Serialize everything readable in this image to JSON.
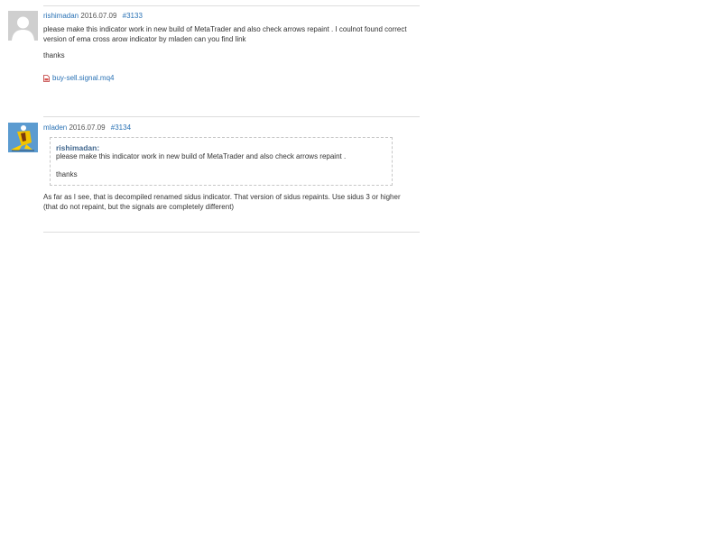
{
  "posts": [
    {
      "author": "rishimadan",
      "date": "2016.07.09",
      "number": "#3133",
      "avatar_icon": "default-user-avatar-icon",
      "paragraphs": [
        "please make this indicator work in new build of MetaTrader and also check arrows repaint . I coulnot found correct version of ema cross arow indicator by mladen can you find link",
        "thanks"
      ],
      "attachment": {
        "icon": "file-icon",
        "name": "buy-sell.signal.mq4"
      }
    },
    {
      "author": "mladen",
      "date": "2016.07.09",
      "number": "#3134",
      "avatar_icon": "mladen-avatar-icon",
      "quote": {
        "author": "rishimadan:",
        "paragraphs": [
          "please make this indicator work in new build of MetaTrader and also check arrows repaint .",
          "thanks"
        ]
      },
      "paragraphs": [
        "As far as I see, that is decompiled renamed sidus indicator. That version of sidus repaints. Use sidus 3 or higher (that do not repaint, but the signals are completely different)"
      ]
    }
  ],
  "colors": {
    "link": "#2a72b5",
    "quote_author": "#41678e",
    "separator": "#dddddd"
  }
}
